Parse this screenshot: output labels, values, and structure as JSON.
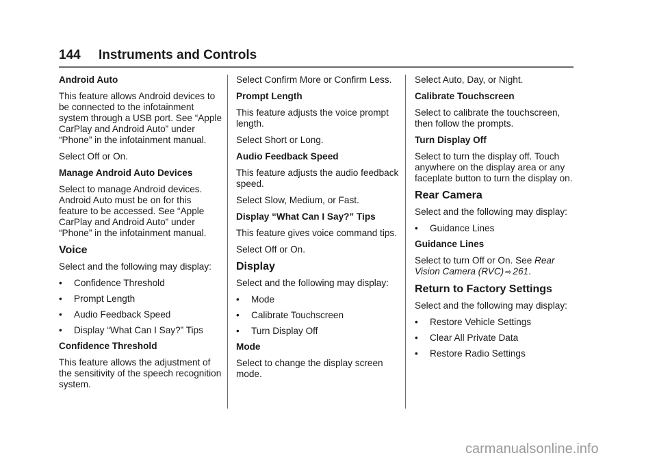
{
  "header": {
    "page_number": "144",
    "title": "Instruments and Controls"
  },
  "col1": {
    "android_auto": {
      "heading": "Android Auto",
      "body": "This feature allows Android devices to be connected to the infotainment system through a USB port. See “Apple CarPlay and Android Auto” under “Phone” in the infotainment manual.",
      "select": "Select Off or On."
    },
    "manage_devices": {
      "heading": "Manage Android Auto Devices",
      "body": "Select to manage Android devices. Android Auto must be on for this feature to be accessed. See “Apple CarPlay and Android Auto” under “Phone” in the infotainment manual."
    },
    "voice": {
      "heading": "Voice",
      "intro": "Select and the following may display:",
      "bullets": [
        "Confidence Threshold",
        "Prompt Length",
        "Audio Feedback Speed",
        "Display “What Can I Say?” Tips"
      ]
    },
    "confidence": {
      "heading": "Confidence Threshold",
      "body": "This feature allows the adjustment of the sensitivity of the speech recognition system."
    }
  },
  "col2": {
    "confirm": "Select Confirm More or Confirm Less.",
    "prompt_length": {
      "heading": "Prompt Length",
      "body": "This feature adjusts the voice prompt length.",
      "select": "Select Short or Long."
    },
    "audio_speed": {
      "heading": "Audio Feedback Speed",
      "body": "This feature adjusts the audio feedback speed.",
      "select": "Select Slow, Medium, or Fast."
    },
    "tips": {
      "heading": "Display “What Can I Say?” Tips",
      "body": "This feature gives voice command tips.",
      "select": "Select Off or On."
    },
    "display": {
      "heading": "Display",
      "intro": "Select and the following may display:",
      "bullets": [
        "Mode",
        "Calibrate Touchscreen",
        "Turn Display Off"
      ]
    },
    "mode": {
      "heading": "Mode",
      "body": "Select to change the display screen mode."
    }
  },
  "col3": {
    "mode_select": "Select Auto, Day, or Night.",
    "calibrate": {
      "heading": "Calibrate Touchscreen",
      "body": "Select to calibrate the touchscreen, then follow the prompts."
    },
    "turn_off": {
      "heading": "Turn Display Off",
      "body": "Select to turn the display off. Touch anywhere on the display area or any faceplate button to turn the display on."
    },
    "rear_camera": {
      "heading": "Rear Camera",
      "intro": "Select and the following may display:",
      "bullets": [
        "Guidance Lines"
      ]
    },
    "guidance": {
      "heading": "Guidance Lines",
      "body_prefix": "Select to turn Off or On. See ",
      "xref_title": "Rear Vision Camera (RVC)",
      "xref_icon": "⇨",
      "xref_page": "261",
      "body_suffix": "."
    },
    "factory": {
      "heading": "Return to Factory Settings",
      "intro": "Select and the following may display:",
      "bullets": [
        "Restore Vehicle Settings",
        "Clear All Private Data",
        "Restore Radio Settings"
      ]
    }
  },
  "bullet_glyph": "•",
  "watermark": "carmanualsonline.info"
}
